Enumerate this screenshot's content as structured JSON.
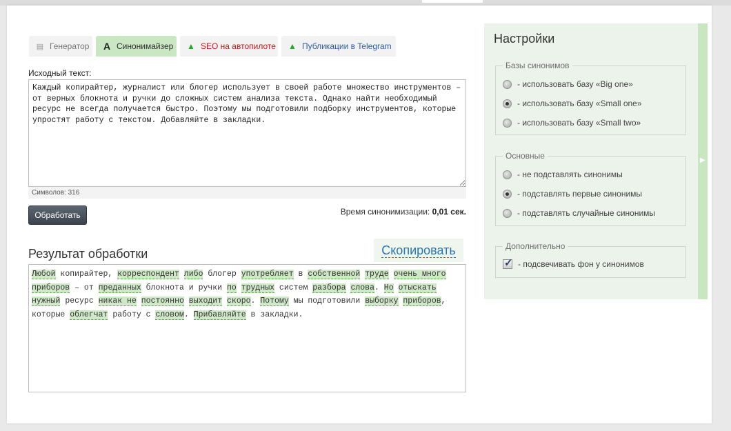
{
  "tabs": {
    "generator": {
      "label": "Генератор",
      "icon": "document-icon"
    },
    "synonymizer": {
      "label": "Синонимайзер",
      "icon": "letter-a-icon"
    },
    "seo": {
      "label": "SEO на автопилоте",
      "icon": "arrow-up-icon"
    },
    "telegram": {
      "label": "Публикации в Telegram",
      "icon": "arrow-up-icon"
    }
  },
  "source": {
    "label": "Исходный текст:",
    "text": "Каждый копирайтер, журналист или блогер использует в своей работе множество инструментов – от верных блокнота и ручки до сложных систем анализа текста. Однако найти необходимый ресурс не всегда получается быстро. Поэтому мы подготовили подборку инструментов, которые упростят работу с текстом. Добавляйте в закладки.",
    "char_count": "Символов: 316"
  },
  "process_button": "Обработать",
  "timing": {
    "label": "Время синонимизации:",
    "value": "0,01 сек."
  },
  "result": {
    "title": "Результат обработки",
    "copy_label": "Скопировать",
    "segments": [
      {
        "t": "Любой",
        "s": true
      },
      {
        "t": " копирайтер, ",
        "s": false
      },
      {
        "t": "корреспондент",
        "s": true
      },
      {
        "t": " ",
        "s": false
      },
      {
        "t": "либо",
        "s": true
      },
      {
        "t": " блогер ",
        "s": false
      },
      {
        "t": "употребляет",
        "s": true
      },
      {
        "t": " в ",
        "s": false
      },
      {
        "t": "собственной",
        "s": true
      },
      {
        "t": " ",
        "s": false
      },
      {
        "t": "труде",
        "s": true
      },
      {
        "t": " ",
        "s": false
      },
      {
        "t": "очень много",
        "s": true
      },
      {
        "t": " ",
        "s": false
      },
      {
        "t": "приборов",
        "s": true
      },
      {
        "t": " – от ",
        "s": false
      },
      {
        "t": "преданных",
        "s": true
      },
      {
        "t": " блокнота и ручки ",
        "s": false
      },
      {
        "t": "по",
        "s": true
      },
      {
        "t": " ",
        "s": false
      },
      {
        "t": "трудных",
        "s": true
      },
      {
        "t": " систем ",
        "s": false
      },
      {
        "t": "разбора",
        "s": true
      },
      {
        "t": " ",
        "s": false
      },
      {
        "t": "слова",
        "s": true
      },
      {
        "t": ". ",
        "s": false
      },
      {
        "t": "Но",
        "s": true
      },
      {
        "t": " ",
        "s": false
      },
      {
        "t": "отыскать",
        "s": true
      },
      {
        "t": " ",
        "s": false
      },
      {
        "t": "нужный",
        "s": true
      },
      {
        "t": " ресурс ",
        "s": false
      },
      {
        "t": "никак не",
        "s": true
      },
      {
        "t": " ",
        "s": false
      },
      {
        "t": "постоянно",
        "s": true
      },
      {
        "t": " ",
        "s": false
      },
      {
        "t": "выходит",
        "s": true
      },
      {
        "t": " ",
        "s": false
      },
      {
        "t": "скоро",
        "s": true
      },
      {
        "t": ". ",
        "s": false
      },
      {
        "t": "Потому",
        "s": true
      },
      {
        "t": " мы подготовили ",
        "s": false
      },
      {
        "t": "выборку",
        "s": true
      },
      {
        "t": " ",
        "s": false
      },
      {
        "t": "приборов",
        "s": true
      },
      {
        "t": ", которые ",
        "s": false
      },
      {
        "t": "облегчат",
        "s": true
      },
      {
        "t": " работу с ",
        "s": false
      },
      {
        "t": "словом",
        "s": true
      },
      {
        "t": ". ",
        "s": false
      },
      {
        "t": "Прибавляйте",
        "s": true
      },
      {
        "t": " в закладки.",
        "s": false
      }
    ]
  },
  "settings": {
    "title": "Настройки",
    "bases": {
      "legend": "Базы синонимов",
      "options": [
        "- использовать базу «Big one»",
        "- использовать базу «Small one»",
        "- использовать базу «Small two»"
      ],
      "selected": 1
    },
    "main": {
      "legend": "Основные",
      "options": [
        "- не подставлять синонимы",
        "- подставлять первые синонимы",
        "- подставлять случайные синонимы"
      ],
      "selected": 1
    },
    "extra": {
      "legend": "Дополнительно",
      "checkbox_label": "- подсвечивать фон у синонимов",
      "checked": true
    }
  },
  "colors": {
    "accent_green": "#c9e7c3",
    "synonym_bg": "#cfe8c7",
    "link_blue": "#2a75b8",
    "seo_red": "#c61a1a"
  }
}
